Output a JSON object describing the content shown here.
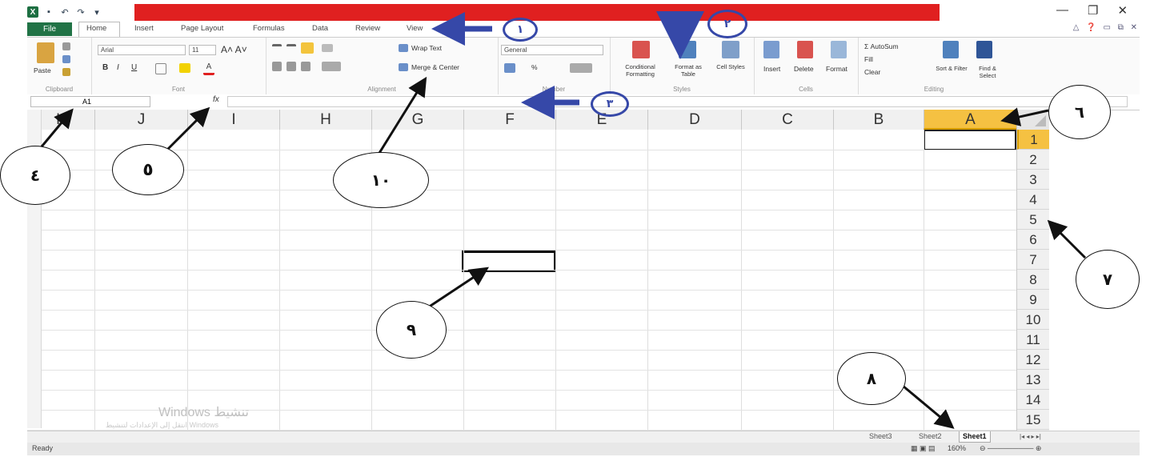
{
  "title_bar": {
    "quick_access": [
      "excel-icon",
      "save-icon",
      "undo-icon",
      "redo-icon",
      "customize-icon"
    ],
    "window_controls": [
      "—",
      "❐",
      "✕"
    ]
  },
  "tabs": [
    "File",
    "Home",
    "Insert",
    "Page Layout",
    "Formulas",
    "Data",
    "Review",
    "View"
  ],
  "ribbon": {
    "clipboard": {
      "paste": "Paste",
      "label": "Clipboard"
    },
    "font": {
      "name": "Arial",
      "size": "11",
      "bold": "B",
      "italic": "I",
      "underline": "U",
      "label": "Font"
    },
    "alignment": {
      "wrap": "Wrap Text",
      "merge": "Merge & Center",
      "label": "Alignment"
    },
    "number": {
      "format": "General",
      "percent": "%",
      "label": "Number"
    },
    "styles": {
      "conditional": "Conditional Formatting",
      "format_table": "Format as Table",
      "cell_styles": "Cell Styles",
      "label": "Styles"
    },
    "cells": {
      "insert": "Insert",
      "delete": "Delete",
      "format": "Format",
      "label": "Cells"
    },
    "editing": {
      "autosum": "Σ AutoSum",
      "fill": "Fill",
      "clear": "Clear",
      "sort": "Sort & Filter",
      "find": "Find & Select",
      "label": "Editing"
    }
  },
  "formula_bar": {
    "name_box": "A1",
    "fx": "fx"
  },
  "columns": [
    "K",
    "J",
    "I",
    "H",
    "G",
    "F",
    "E",
    "D",
    "C",
    "B",
    "A"
  ],
  "rows": [
    "1",
    "2",
    "3",
    "4",
    "5",
    "6",
    "7",
    "8",
    "9",
    "10",
    "11",
    "12",
    "13",
    "14",
    "15"
  ],
  "sheets": [
    "Sheet3",
    "Sheet2",
    "Sheet1"
  ],
  "status": {
    "ready": "Ready",
    "zoom": "160%"
  },
  "watermark": {
    "line1": "Windows تنشيط",
    "line2": "انتقل إلى الإعدادات لتنشيط Windows"
  },
  "annotations": {
    "c1": "١",
    "c2": "٢",
    "c3": "٣",
    "c4": "٤",
    "c5": "٥",
    "c6": "٦",
    "c7": "٧",
    "c8": "٨",
    "c9": "٩",
    "c10": "١٠"
  },
  "colors": {
    "file_tab": "#217346",
    "title_highlight": "#e02020",
    "selected_header": "#f5c142",
    "arrow_blue": "#3648a8"
  }
}
